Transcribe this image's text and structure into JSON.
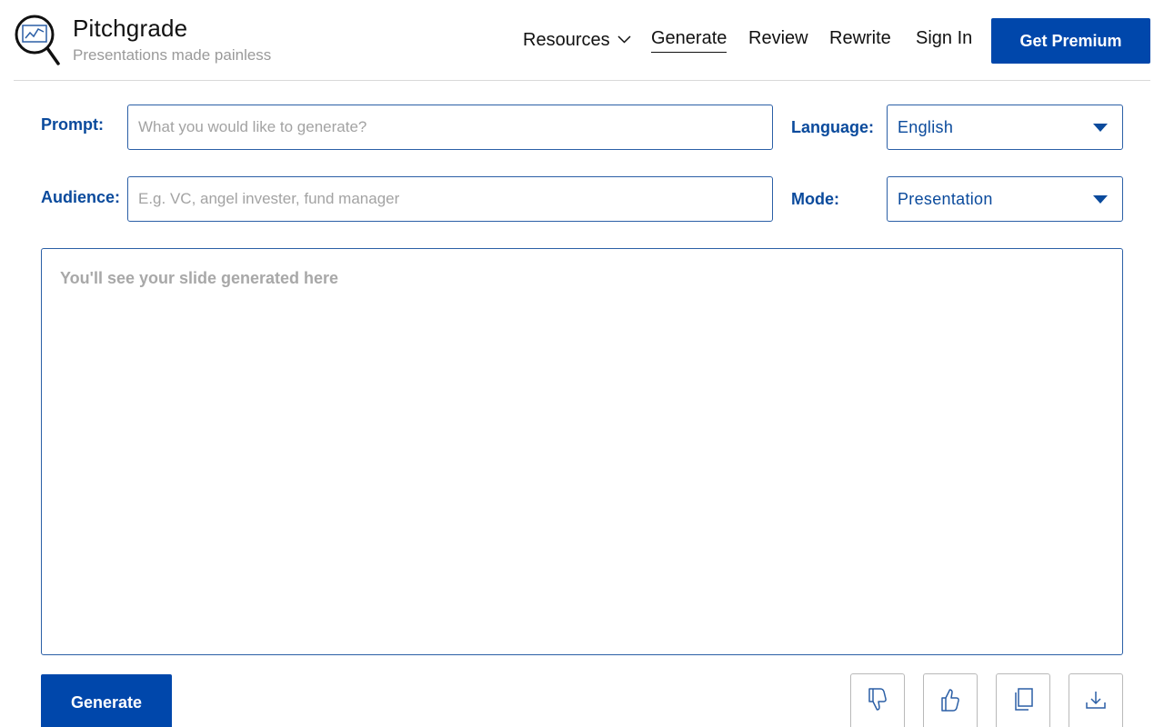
{
  "brand": {
    "name": "Pitchgrade",
    "tagline": "Presentations made painless",
    "logo_icon": "magnifier-chart-icon"
  },
  "nav": {
    "resources": "Resources",
    "generate": "Generate",
    "review": "Review",
    "rewrite": "Rewrite",
    "sign_in": "Sign In",
    "active": "Generate"
  },
  "header": {
    "premium_label": "Get Premium"
  },
  "form": {
    "prompt_label": "Prompt:",
    "prompt_placeholder": "What you would like to generate?",
    "prompt_value": "",
    "audience_label": "Audience:",
    "audience_placeholder": "E.g. VC, angel invester, fund manager",
    "audience_value": "",
    "language_label": "Language:",
    "language_value": "English",
    "mode_label": "Mode:",
    "mode_value": "Presentation"
  },
  "output": {
    "placeholder": "You'll see your slide generated here"
  },
  "actions": {
    "generate_label": "Generate",
    "icons": [
      "thumbs-down-icon",
      "thumbs-up-icon",
      "copy-icon",
      "download-icon"
    ]
  },
  "colors": {
    "accent": "#0047ab",
    "label_blue": "#0a4a9c",
    "border_blue": "#2b5fa6",
    "placeholder_gray": "#a3a3a3"
  }
}
